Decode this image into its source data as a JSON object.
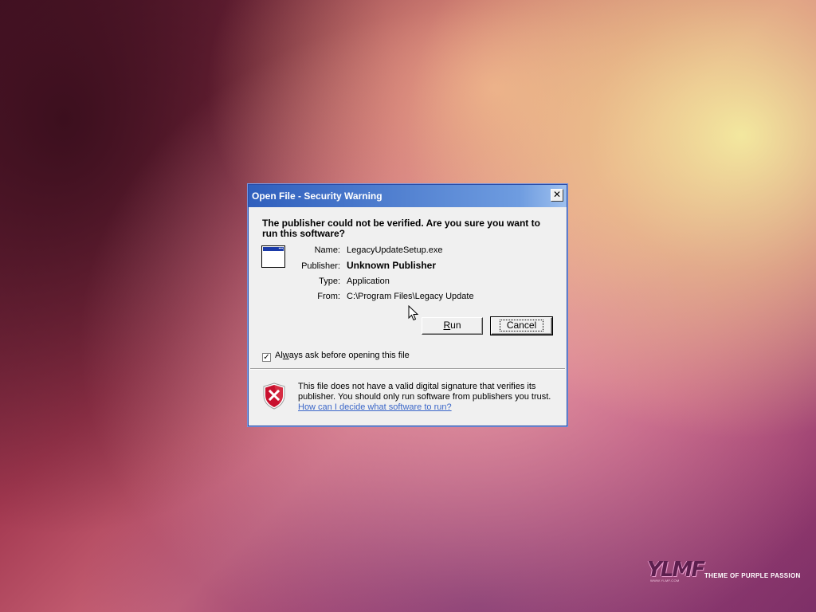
{
  "dialog": {
    "title": "Open File - Security Warning",
    "close_glyph": "✕",
    "heading": "The publisher could not be verified.  Are you sure you want to run this software?",
    "fields": [
      {
        "label": "Name:",
        "value": "LegacyUpdateSetup.exe"
      },
      {
        "label": "Publisher:",
        "value": "Unknown Publisher"
      },
      {
        "label": "Type:",
        "value": "Application"
      },
      {
        "label": "From:",
        "value": "C:\\Program Files\\Legacy Update"
      }
    ],
    "buttons": {
      "run_label": "Run",
      "run_accesskey": "R",
      "run_rest": "un",
      "cancel_label": "Cancel"
    },
    "checkbox": {
      "checked": true,
      "check_glyph": "✓",
      "label_pre": "Al",
      "label_accesskey": "w",
      "label_post": "ays ask before opening this file"
    },
    "warning": {
      "text": "This file does not have a valid digital signature that verifies its publisher.  You should only run software from publishers you trust.",
      "link_text": "How can I decide what software to run?"
    }
  },
  "icons": {
    "app": "application-window-icon",
    "shield": "security-shield-error-icon",
    "close": "close-icon",
    "cursor": "mouse-pointer-icon"
  },
  "brand": {
    "logo": "YLMF",
    "tagline": "THEME OF PURPLE PASSION",
    "site": "WWW.YLMF.COM"
  },
  "colors": {
    "title_bar": "#2f5fbd",
    "dialog_bg": "#f0f0f0",
    "link": "#3a66c8",
    "shield_red": "#c8102e"
  }
}
